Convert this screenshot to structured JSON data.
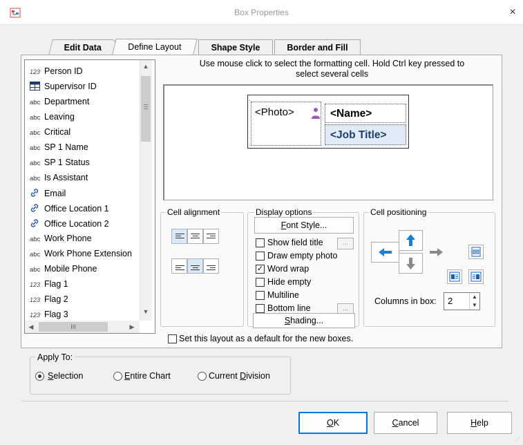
{
  "window": {
    "title": "Box Properties",
    "close_glyph": "×"
  },
  "tabs": [
    {
      "label": "Edit Data"
    },
    {
      "label": "Define Layout",
      "active": true
    },
    {
      "label": "Shape Style"
    },
    {
      "label": "Border and Fill"
    }
  ],
  "fields": [
    {
      "type": "numeric",
      "icon": "123",
      "label": "Person ID"
    },
    {
      "type": "table",
      "icon": "table-icon",
      "label": "Supervisor ID"
    },
    {
      "type": "text",
      "icon": "abc",
      "label": "Department"
    },
    {
      "type": "text",
      "icon": "abc",
      "label": "Leaving"
    },
    {
      "type": "text",
      "icon": "abc",
      "label": "Critical"
    },
    {
      "type": "text",
      "icon": "abc",
      "label": "SP 1 Name"
    },
    {
      "type": "text",
      "icon": "abc",
      "label": "SP 1 Status"
    },
    {
      "type": "text",
      "icon": "abc",
      "label": "Is Assistant"
    },
    {
      "type": "link",
      "icon": "link-icon",
      "label": "Email"
    },
    {
      "type": "link",
      "icon": "link-icon",
      "label": "Office Location 1"
    },
    {
      "type": "link",
      "icon": "link-icon",
      "label": "Office Location 2"
    },
    {
      "type": "text",
      "icon": "abc",
      "label": "Work Phone"
    },
    {
      "type": "text",
      "icon": "abc",
      "label": "Work Phone Extension"
    },
    {
      "type": "text",
      "icon": "abc",
      "label": "Mobile Phone"
    },
    {
      "type": "numeric",
      "icon": "123",
      "label": "Flag 1"
    },
    {
      "type": "numeric",
      "icon": "123",
      "label": "Flag 2"
    },
    {
      "type": "numeric",
      "icon": "123",
      "label": "Flag 3"
    }
  ],
  "list_scroll": {
    "hthumb_label": "III"
  },
  "instruction": {
    "line1": "Use mouse click to select the formatting cell. Hold Ctrl key pressed to",
    "line2": "select several cells"
  },
  "preview": {
    "photo": "<Photo>",
    "name": "<Name>",
    "job_title": "<Job Title>"
  },
  "cell_alignment": {
    "label": "Cell alignment",
    "selected": [
      "top-left",
      "bottom-center"
    ]
  },
  "display_options": {
    "label": "Display options",
    "font_style_button": "Font Style...",
    "font_style_mnemonic": "F",
    "shading_button": "Shading...",
    "shading_mnemonic": "S",
    "checkboxes": [
      {
        "label": "Show field title",
        "checked": false,
        "has_dots": true
      },
      {
        "label": "Draw empty photo",
        "checked": false
      },
      {
        "label": "Word wrap",
        "checked": true
      },
      {
        "label": "Hide empty",
        "checked": false
      },
      {
        "label": "Multiline",
        "checked": false
      },
      {
        "label": "Bottom line",
        "checked": false,
        "has_dots": true
      }
    ],
    "dots_label": "..."
  },
  "cell_positioning": {
    "label": "Cell positioning",
    "columns_label": "Columns in box:",
    "columns_value": "2"
  },
  "default_layout": {
    "label": "Set this layout as a default for the new boxes.",
    "checked": false
  },
  "apply_to": {
    "label": "Apply To:",
    "options": [
      {
        "label": "Selection",
        "mnemonic": "S",
        "rest": "election",
        "selected": true
      },
      {
        "label": "Entire Chart",
        "mnemonic": "E",
        "rest": "ntire Chart",
        "selected": false
      },
      {
        "label": "Current Division",
        "pre": "Current ",
        "mnemonic": "D",
        "rest": "ivision",
        "selected": false
      }
    ]
  },
  "buttons": {
    "ok": {
      "mnemonic": "O",
      "rest": "K"
    },
    "cancel": {
      "mnemonic": "C",
      "rest": "ancel"
    },
    "help": {
      "mnemonic": "H",
      "rest": "elp"
    }
  },
  "colors": {
    "accent": "#0078d7",
    "arrow_blue": "#1a7fd4",
    "arrow_gray": "#8a8a8a",
    "selected_cell": "#e1ebf5"
  }
}
